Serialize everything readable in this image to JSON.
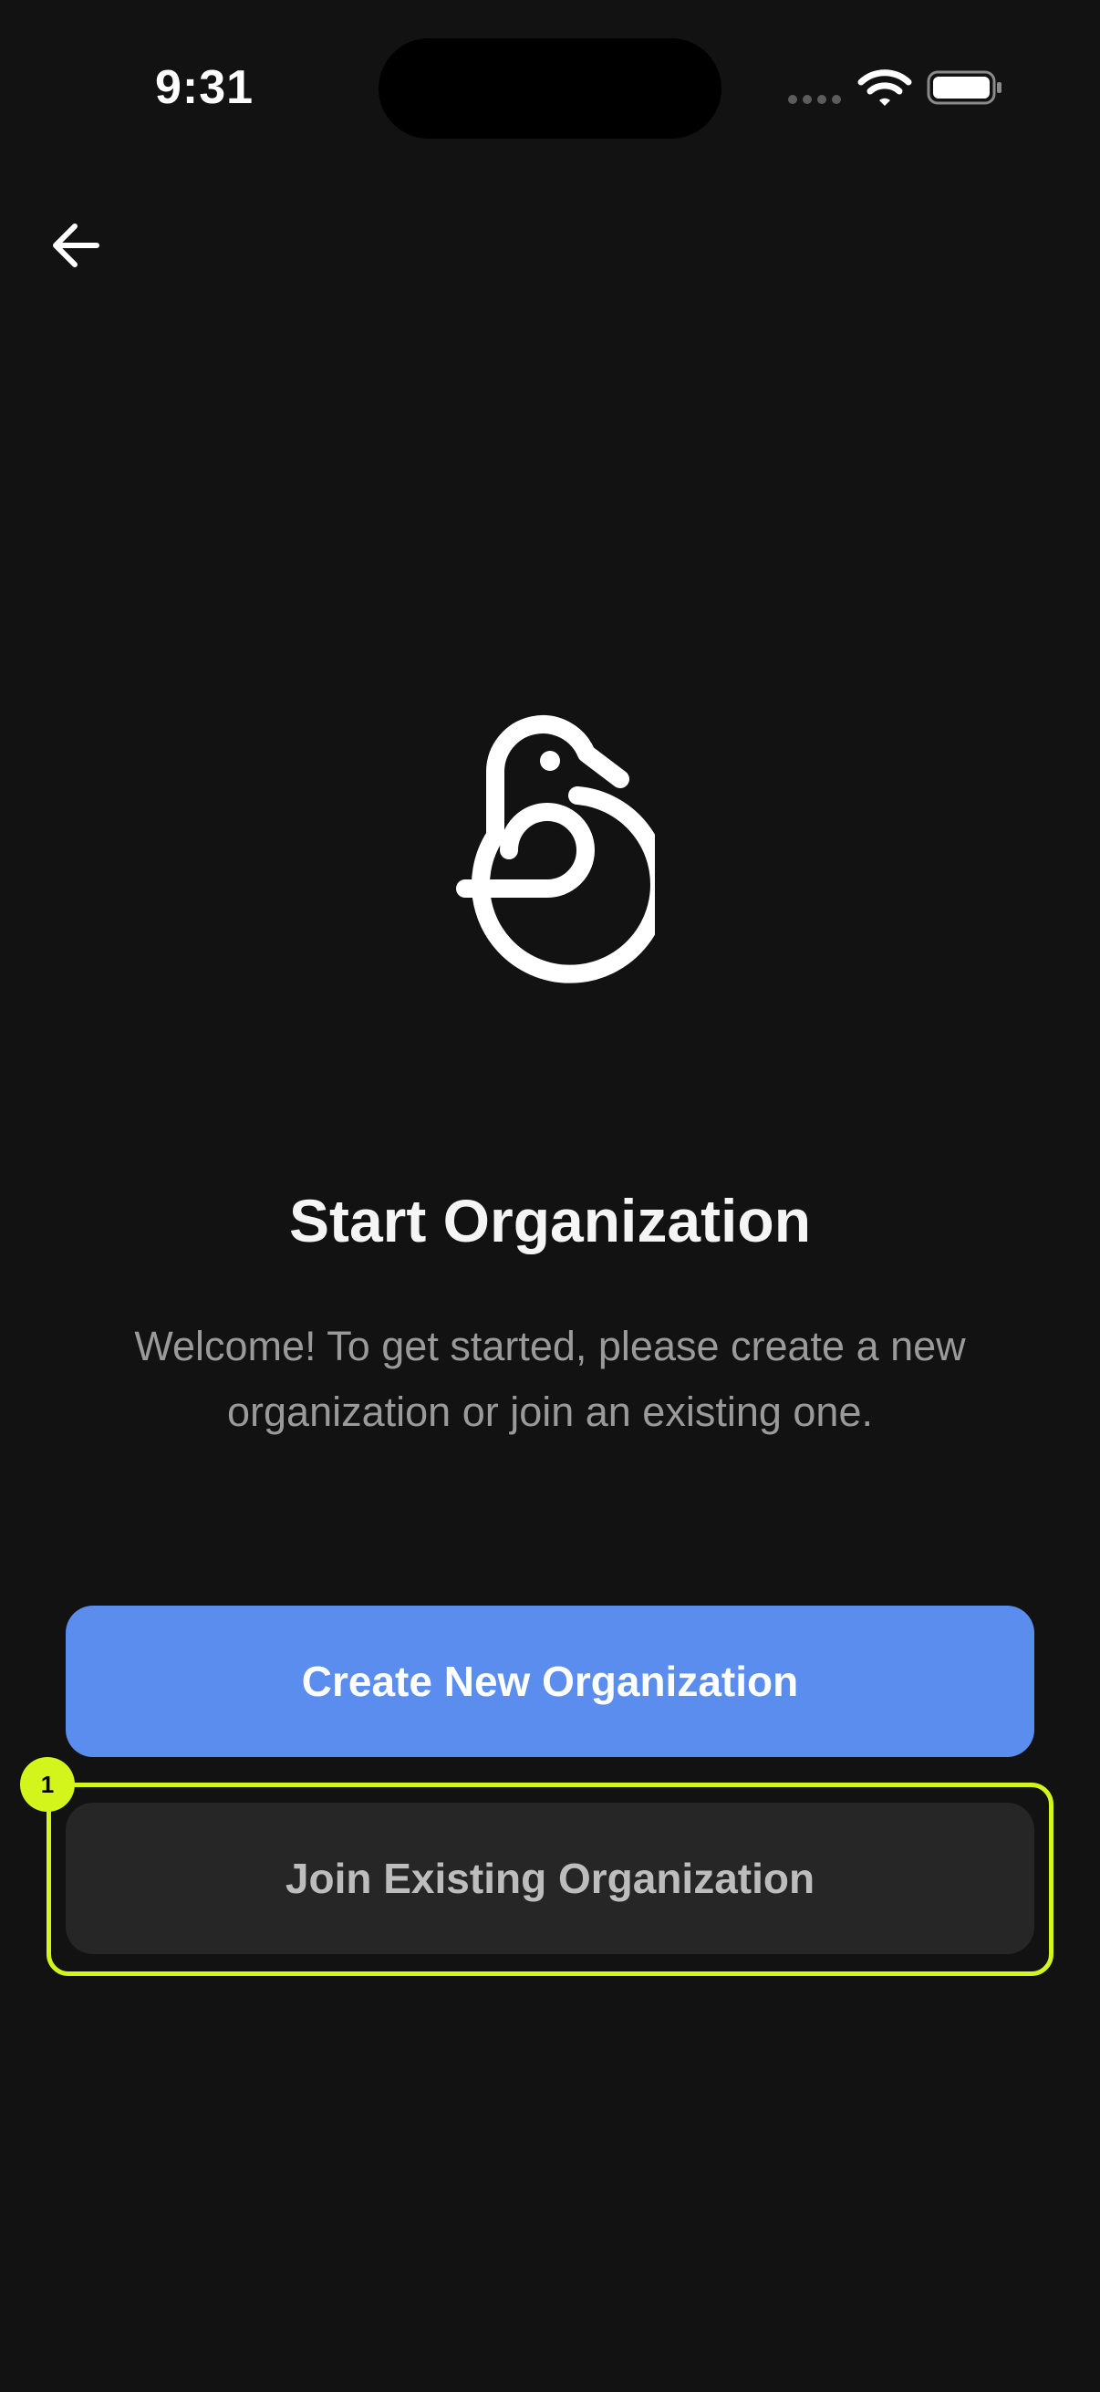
{
  "status_bar": {
    "time": "9:31"
  },
  "header": {
    "back_icon": "arrow-left-icon"
  },
  "logo": {
    "icon": "swan-logo-icon"
  },
  "main": {
    "title": "Start Organization",
    "subtitle": "Welcome! To get started, please create a new organization or join an existing one."
  },
  "actions": {
    "create_label": "Create New Organization",
    "join_label": "Join Existing Organization"
  },
  "annotation": {
    "badge": "1"
  },
  "colors": {
    "background": "#121212",
    "primary": "#5b8def",
    "secondary_button": "#262626",
    "highlight": "#d4f51c",
    "subtitle_text": "#9a9a9a"
  }
}
